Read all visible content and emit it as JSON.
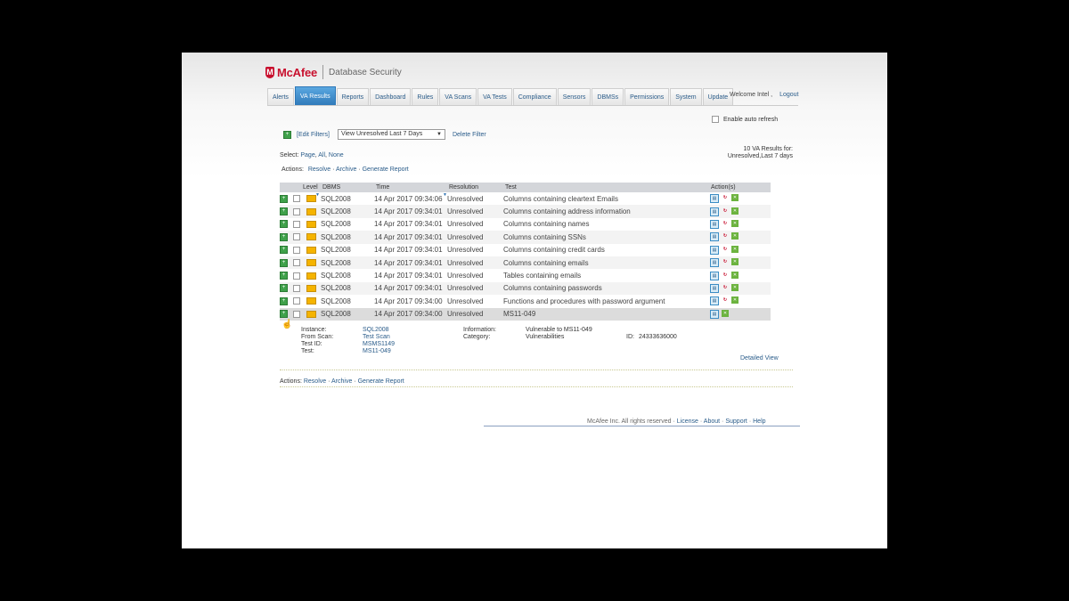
{
  "brand": {
    "name": "McAfee",
    "product": "Database Security"
  },
  "nav": {
    "tabs": [
      "Alerts",
      "VA Results",
      "Reports",
      "Dashboard",
      "Rules",
      "VA Scans",
      "VA Tests",
      "Compliance",
      "Sensors",
      "DBMSs",
      "Permissions",
      "System",
      "Update"
    ],
    "active": "VA Results",
    "welcome": "Welcome  Intel ,",
    "logout": "Logout"
  },
  "auto_refresh_label": "Enable auto refresh",
  "filters": {
    "edit_label": "[Edit Filters]",
    "view_value": "View Unresolved Last 7 Days",
    "delete_label": "Delete Filter"
  },
  "select": {
    "label": "Select:",
    "page": "Page",
    "all": "All",
    "none": "None"
  },
  "results_count": {
    "line1": "10 VA Results for:",
    "line2": "Unresolved,Last 7 days"
  },
  "actions": {
    "label": "Actions:",
    "resolve": "Resolve",
    "archive": "Archive",
    "generate": "Generate Report",
    "sep": "·"
  },
  "table": {
    "headers": {
      "level": "Level",
      "dbms": "DBMS",
      "time": "Time",
      "resolution": "Resolution",
      "test": "Test",
      "actions": "Action(s)"
    },
    "rows": [
      {
        "dbms": "SQL2008",
        "time": "14 Apr 2017 09:34:06",
        "resolution": "Unresolved",
        "test": "Columns containing cleartext Emails"
      },
      {
        "dbms": "SQL2008",
        "time": "14 Apr 2017 09:34:01",
        "resolution": "Unresolved",
        "test": "Columns containing address information"
      },
      {
        "dbms": "SQL2008",
        "time": "14 Apr 2017 09:34:01",
        "resolution": "Unresolved",
        "test": "Columns containing names"
      },
      {
        "dbms": "SQL2008",
        "time": "14 Apr 2017 09:34:01",
        "resolution": "Unresolved",
        "test": "Columns containing SSNs"
      },
      {
        "dbms": "SQL2008",
        "time": "14 Apr 2017 09:34:01",
        "resolution": "Unresolved",
        "test": "Columns containing credit cards"
      },
      {
        "dbms": "SQL2008",
        "time": "14 Apr 2017 09:34:01",
        "resolution": "Unresolved",
        "test": "Columns containing emails"
      },
      {
        "dbms": "SQL2008",
        "time": "14 Apr 2017 09:34:01",
        "resolution": "Unresolved",
        "test": "Tables containing emails"
      },
      {
        "dbms": "SQL2008",
        "time": "14 Apr 2017 09:34:01",
        "resolution": "Unresolved",
        "test": "Columns containing passwords"
      },
      {
        "dbms": "SQL2008",
        "time": "14 Apr 2017 09:34:00",
        "resolution": "Unresolved",
        "test": "Functions and procedures with password argument"
      },
      {
        "dbms": "SQL2008",
        "time": "14 Apr 2017 09:34:00",
        "resolution": "Unresolved",
        "test": "MS11-049"
      }
    ]
  },
  "detail": {
    "instance_label": "Instance:",
    "instance_value": "SQL2008",
    "scan_label": "From Scan:",
    "scan_value": "Test Scan",
    "testid_label": "Test ID:",
    "testid_value": "MSMS1149",
    "test_label": "Test:",
    "test_value": "MS11-049",
    "info_label": "Information:",
    "info_value": "Vulnerable to MS11-049",
    "category_label": "Category:",
    "category_value": "Vulnerabilities",
    "id_label": "ID:",
    "id_value": "24333636000",
    "detailed_view": "Detailed View"
  },
  "footer": {
    "copyright": "McAfee Inc. All rights reserved",
    "license": "License",
    "about": "About",
    "support": "Support",
    "help": "Help",
    "sep": "·"
  },
  "colors": {
    "brand_red": "#c8102e",
    "link_blue": "#2a5c8a",
    "active_tab": "#2e78b8"
  }
}
